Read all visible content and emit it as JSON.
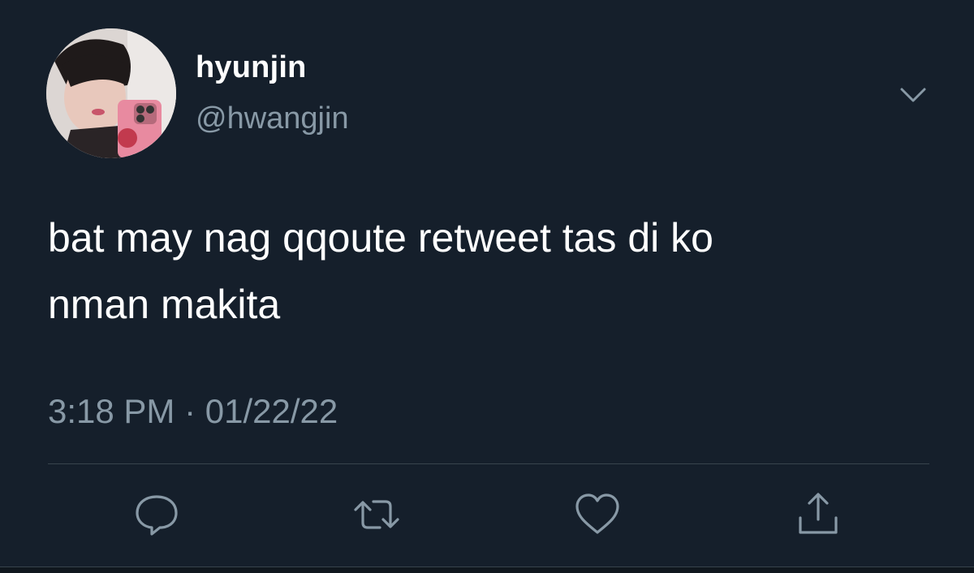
{
  "tweet": {
    "display_name": "hyunjin",
    "handle": "@hwangjin",
    "text_line1": "bat may nag qqoute retweet tas di ko",
    "text_line2": "nman makita",
    "timestamp": "3:18 PM · 01/22/22"
  },
  "icons": {
    "menu": "chevron-down-icon",
    "reply": "reply-icon",
    "retweet": "retweet-icon",
    "like": "heart-icon",
    "share": "share-icon"
  },
  "colors": {
    "background": "#151f2b",
    "primary_text": "#ffffff",
    "secondary_text": "#8899a6",
    "divider": "#38444d"
  }
}
